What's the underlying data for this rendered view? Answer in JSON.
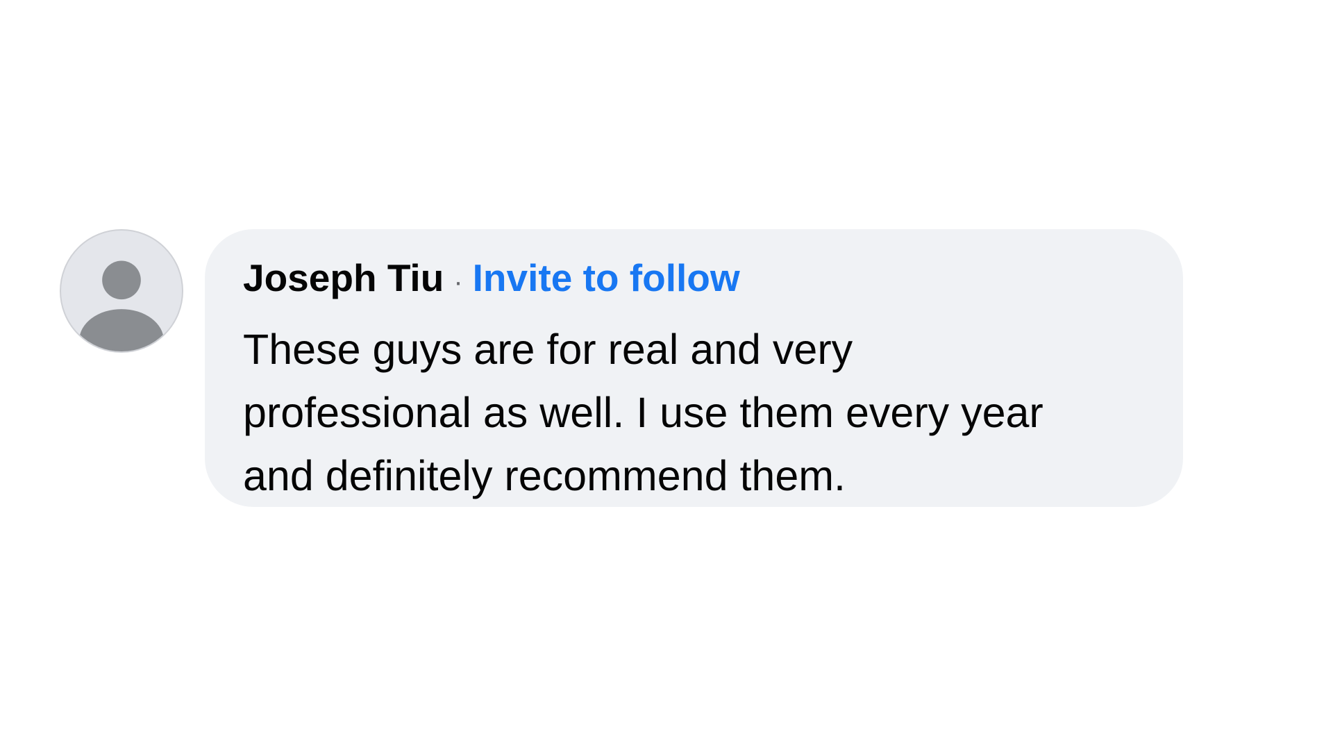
{
  "comment": {
    "avatar_icon": "default-profile-icon",
    "author": "Joseph Tiu",
    "separator": "·",
    "action_label": "Invite to follow",
    "text": "These guys are for real and very professional as well. I use them every year and definitely recommend them.",
    "text_lines": [
      "These guys are for real and very",
      "professional as well. I use them every year",
      "and definitely recommend them."
    ]
  },
  "colors": {
    "background": "#ffffff",
    "bubble": "#f0f2f5",
    "text": "#050505",
    "link": "#1877f2",
    "avatar_bg": "#e4e6eb",
    "avatar_figure": "#8a8d91"
  }
}
